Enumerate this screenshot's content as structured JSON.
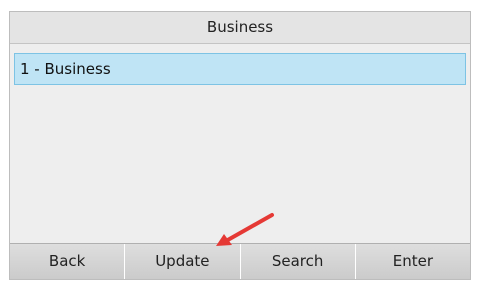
{
  "header": {
    "title": "Business"
  },
  "list": {
    "items": [
      {
        "label": "1 - Business",
        "selected": true
      }
    ]
  },
  "softkeys": {
    "back": "Back",
    "update": "Update",
    "search": "Search",
    "enter": "Enter"
  },
  "annotation": {
    "arrow_color": "#e53935",
    "points_to": "update-softkey"
  },
  "colors": {
    "selection_fill": "#bfe4f5",
    "selection_border": "#7dc3e4"
  }
}
